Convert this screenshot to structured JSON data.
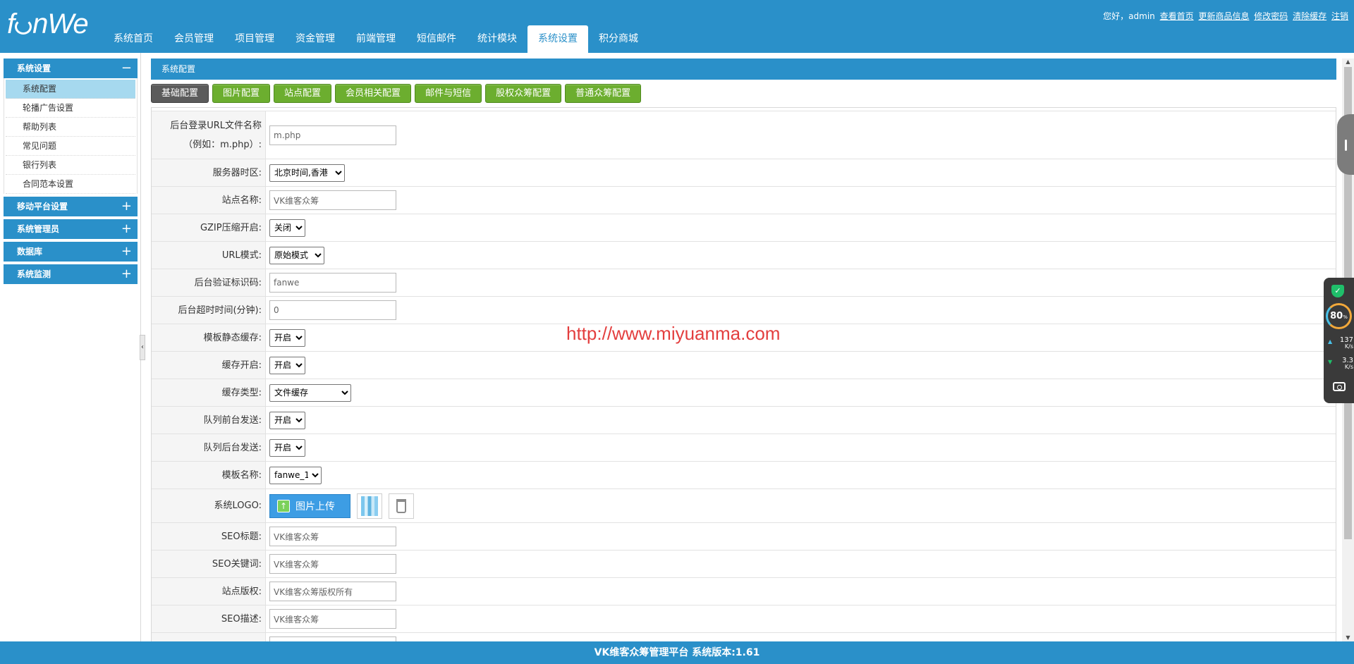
{
  "header": {
    "logo_pre": "f",
    "logo_post": "nWe",
    "nav": [
      {
        "label": "系统首页"
      },
      {
        "label": "会员管理"
      },
      {
        "label": "项目管理"
      },
      {
        "label": "资金管理"
      },
      {
        "label": "前端管理"
      },
      {
        "label": "短信邮件"
      },
      {
        "label": "统计模块"
      },
      {
        "label": "系统设置",
        "active": true
      },
      {
        "label": "积分商城"
      }
    ],
    "greeting": "您好，admin",
    "links": [
      "查看首页",
      "更新商品信息",
      "修改密码",
      "清除缓存",
      "注销"
    ]
  },
  "sidebar": {
    "groups": [
      {
        "title": "系统设置",
        "sign": "−",
        "items": [
          "系统配置",
          "轮播广告设置",
          "帮助列表",
          "常见问题",
          "银行列表",
          "合同范本设置"
        ]
      },
      {
        "title": "移动平台设置",
        "sign": "+"
      },
      {
        "title": "系统管理员",
        "sign": "+"
      },
      {
        "title": "数据库",
        "sign": "+"
      },
      {
        "title": "系统监测",
        "sign": "+"
      }
    ],
    "collapse_glyph": "‹"
  },
  "main": {
    "title": "系统配置",
    "tabs": [
      "基础配置",
      "图片配置",
      "站点配置",
      "会员相关配置",
      "邮件与短信",
      "股权众筹配置",
      "普通众筹配置"
    ],
    "form": {
      "login_url": {
        "label_line1": "后台登录URL文件名称",
        "label_line2": "（例如：m.php）:",
        "value": "m.php"
      },
      "timezone": {
        "label": "服务器时区:",
        "value": "北京时间,香港"
      },
      "site_name": {
        "label": "站点名称:",
        "value": "VK维客众筹"
      },
      "gzip": {
        "label": "GZIP压缩开启:",
        "value": "关闭"
      },
      "url_mode": {
        "label": "URL模式:",
        "value": "原始模式"
      },
      "auth_code": {
        "label": "后台验证标识码:",
        "value": "fanwe"
      },
      "timeout": {
        "label": "后台超时时间(分钟):",
        "value": "0"
      },
      "tpl_cache": {
        "label": "模板静态缓存:",
        "value": "开启"
      },
      "cache_on": {
        "label": "缓存开启:",
        "value": "开启"
      },
      "cache_type": {
        "label": "缓存类型:",
        "value": "文件缓存"
      },
      "queue_front": {
        "label": "队列前台发送:",
        "value": "开启"
      },
      "queue_back": {
        "label": "队列后台发送:",
        "value": "开启"
      },
      "template": {
        "label": "模板名称:",
        "value": "fanwe_1"
      },
      "logo": {
        "label": "系统LOGO:",
        "upload_label": "图片上传"
      },
      "seo_title": {
        "label": "SEO标题:",
        "value": "VK维客众筹"
      },
      "seo_keywords": {
        "label": "SEO关键词:",
        "value": "VK维客众筹"
      },
      "copyright": {
        "label": "站点版权:",
        "value": "VK维客众筹版权所有"
      },
      "seo_desc": {
        "label": "SEO描述:",
        "value": "VK维客众筹"
      }
    }
  },
  "watermark": "http://www.miyuanma.com",
  "monitor": {
    "percent": "80",
    "percent_unit": "%",
    "up": "137",
    "down": "3.3",
    "unit": "K/s"
  },
  "footer": {
    "text": "VK维客众筹管理平台 系统版本:1.61"
  },
  "colors": {
    "primary": "#2a90c9",
    "tab_green": "#6cae2f",
    "tab_active": "#5b5b5b",
    "sidebar_active": "#a6d9ef",
    "watermark": "#e33e3e"
  }
}
